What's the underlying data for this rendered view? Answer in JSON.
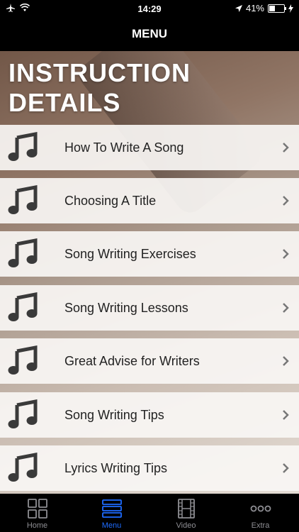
{
  "status": {
    "time": "14:29",
    "battery": "41%",
    "battery_level": 0.41
  },
  "nav": {
    "title": "MENU"
  },
  "header": {
    "title": "INSTRUCTION DETAILS"
  },
  "menu": {
    "items": [
      {
        "label": "How To Write A Song"
      },
      {
        "label": "Choosing A Title"
      },
      {
        "label": "Song Writing Exercises"
      },
      {
        "label": "Song Writing Lessons"
      },
      {
        "label": "Great Advise for Writers"
      },
      {
        "label": "Song Writing Tips"
      },
      {
        "label": "Lyrics Writing Tips"
      }
    ]
  },
  "tabs": [
    {
      "label": "Home",
      "icon": "grid-icon"
    },
    {
      "label": "Menu",
      "icon": "list-icon"
    },
    {
      "label": "Video",
      "icon": "film-icon"
    },
    {
      "label": "Extra",
      "icon": "more-icon"
    }
  ],
  "colors": {
    "accent": "#1e6cff",
    "tab_inactive": "#8e8e93"
  }
}
